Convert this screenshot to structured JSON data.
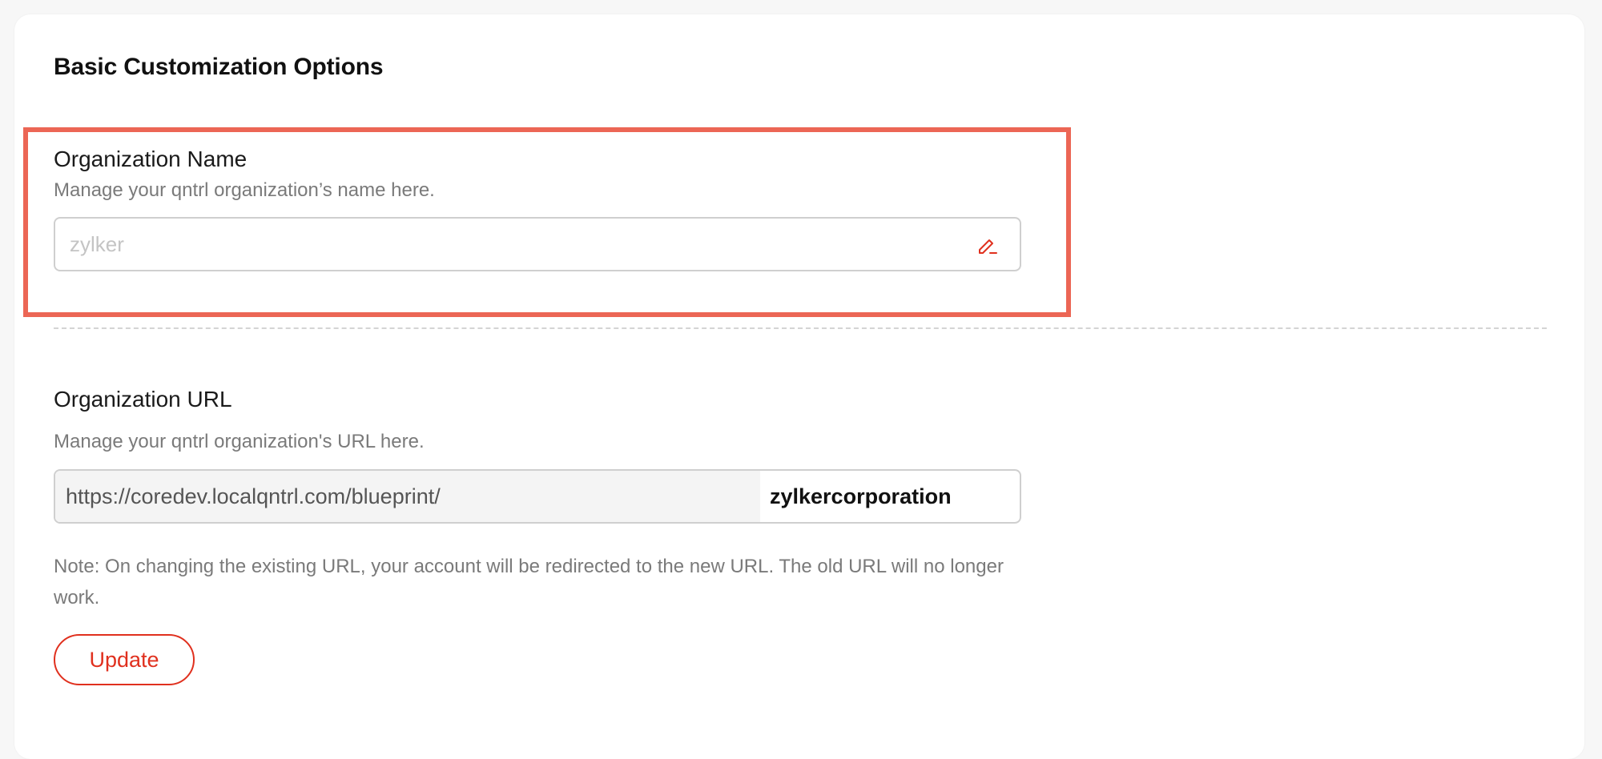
{
  "section": {
    "title": "Basic Customization Options"
  },
  "org_name": {
    "label": "Organization Name",
    "description": "Manage your qntrl organization’s name here.",
    "placeholder": "zylker",
    "edit_icon": "pencil-edit-icon"
  },
  "org_url": {
    "label": "Organization URL",
    "description": "Manage your qntrl organization's URL here.",
    "prefix": "https://coredev.localqntrl.com/blueprint/",
    "slug": "zylkercorporation",
    "note": "Note: On changing the existing URL, your account will be redirected to the new URL. The old URL will no longer work.",
    "update_label": "Update"
  },
  "colors": {
    "accent": "#e0301e",
    "highlight_border": "#ec6655"
  }
}
